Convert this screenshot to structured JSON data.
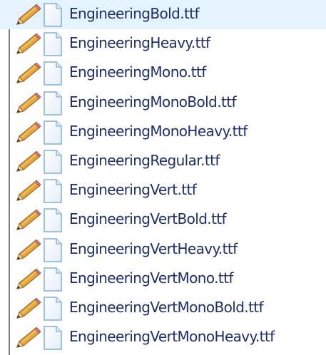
{
  "files": [
    {
      "name": "EngineeringBold.ttf",
      "icon": "edit-pencil-icon",
      "type_icon": "document-icon"
    },
    {
      "name": "EngineeringHeavy.ttf",
      "icon": "edit-pencil-icon",
      "type_icon": "document-icon"
    },
    {
      "name": "EngineeringMono.ttf",
      "icon": "edit-pencil-icon",
      "type_icon": "document-icon"
    },
    {
      "name": "EngineeringMonoBold.ttf",
      "icon": "edit-pencil-icon",
      "type_icon": "document-icon"
    },
    {
      "name": "EngineeringMonoHeavy.ttf",
      "icon": "edit-pencil-icon",
      "type_icon": "document-icon"
    },
    {
      "name": "EngineeringRegular.ttf",
      "icon": "edit-pencil-icon",
      "type_icon": "document-icon"
    },
    {
      "name": "EngineeringVert.ttf",
      "icon": "edit-pencil-icon",
      "type_icon": "document-icon"
    },
    {
      "name": "EngineeringVertBold.ttf",
      "icon": "edit-pencil-icon",
      "type_icon": "document-icon"
    },
    {
      "name": "EngineeringVertHeavy.ttf",
      "icon": "edit-pencil-icon",
      "type_icon": "document-icon"
    },
    {
      "name": "EngineeringVertMono.ttf",
      "icon": "edit-pencil-icon",
      "type_icon": "document-icon"
    },
    {
      "name": "EngineeringVertMonoBold.ttf",
      "icon": "edit-pencil-icon",
      "type_icon": "document-icon"
    },
    {
      "name": "EngineeringVertMonoHeavy.ttf",
      "icon": "edit-pencil-icon",
      "type_icon": "document-icon"
    }
  ],
  "colors": {
    "text": "#1e2d6b",
    "tree_line": "#7f7f7f",
    "pencil_body": "#e8a53a",
    "pencil_tip": "#c98a3c",
    "doc_border": "#7fb0d8"
  }
}
